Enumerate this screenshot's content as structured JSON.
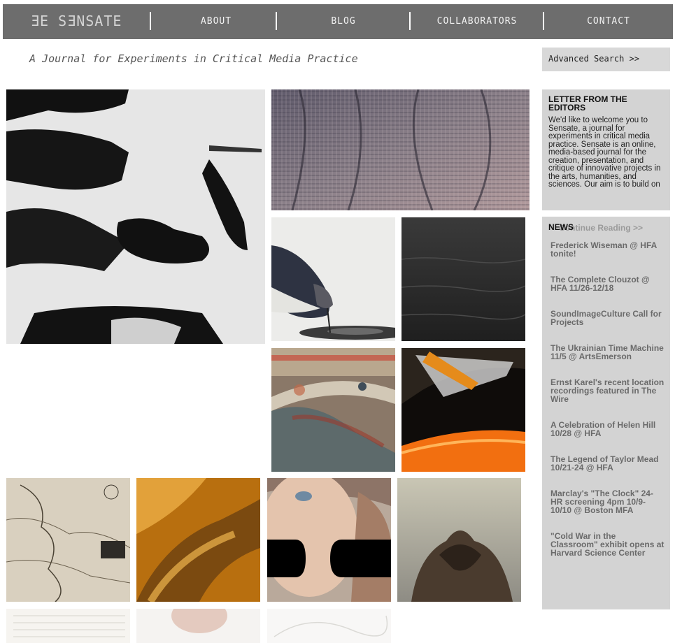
{
  "nav": {
    "logo": "ƎE SƎNSATE",
    "links": [
      "ABOUT",
      "BLOG",
      "COLLABORATORS",
      "CONTACT"
    ]
  },
  "tagline": "A Journal for Experiments in Critical Media Practice",
  "search": {
    "advanced_label": "Advanced Search >>"
  },
  "letter": {
    "title": "LETTER FROM THE EDITORS",
    "body": "We'd like to welcome you to Sensate, a journal for experiments in critical media practice. Sensate is an online, media-based journal for the creation, presentation, and critique of innovative projects in the arts, humanities, and sciences. Our aim is to build on",
    "continue_label": "Continue Reading >>"
  },
  "news": {
    "title": "NEWS",
    "items": [
      "Frederick Wiseman @ HFA tonite!",
      "The Complete Clouzot @ HFA 11/26-12/18",
      "SoundImageCulture Call for Projects",
      "The Ukrainian Time Machine 11/5 @ ArtsEmerson",
      "Ernst Karel's recent location recordings featured in The Wire",
      "A Celebration of Helen Hill 10/28 @ HFA",
      "The Legend of Taylor Mead 10/21-24 @ HFA",
      "Marclay's \"The Clock\" 24-HR screening 4pm 10/9-10/10 @ Boston MFA",
      "\"Cold War in the Classroom\" exhibit opens at Harvard Science Center"
    ]
  },
  "colors": {
    "nav_bg": "#6d6d6d",
    "sidebar_bg": "#d3d3d3",
    "news_link": "#6a6a6a"
  }
}
